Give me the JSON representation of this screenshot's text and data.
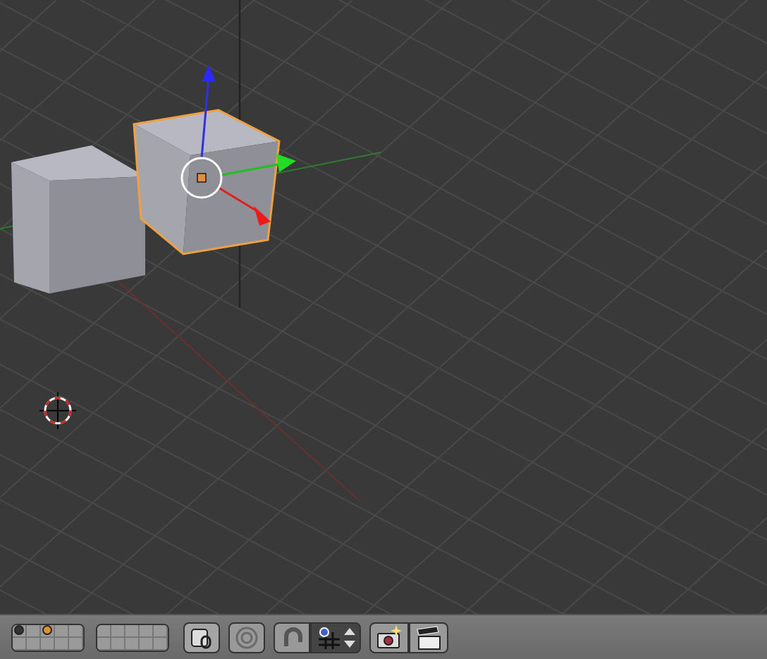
{
  "viewport": {
    "objects": [
      {
        "selected": false
      },
      {
        "selected": true
      }
    ]
  },
  "header": {
    "layer_groups": [
      [
        {
          "kind": "object"
        },
        {
          "kind": "empty"
        },
        {
          "kind": "active_object"
        },
        {
          "kind": "empty"
        },
        {
          "kind": "empty"
        },
        {
          "kind": "empty"
        },
        {
          "kind": "empty"
        },
        {
          "kind": "empty"
        },
        {
          "kind": "empty"
        },
        {
          "kind": "empty"
        }
      ],
      [
        {
          "kind": "empty"
        },
        {
          "kind": "empty"
        },
        {
          "kind": "empty"
        },
        {
          "kind": "empty"
        },
        {
          "kind": "empty"
        },
        {
          "kind": "empty"
        },
        {
          "kind": "empty"
        },
        {
          "kind": "empty"
        },
        {
          "kind": "empty"
        },
        {
          "kind": "empty"
        }
      ]
    ],
    "buttons": [
      {
        "kind": "lock",
        "on": false
      },
      {
        "kind": "proportional",
        "on": false
      },
      {
        "kind": "snap",
        "on": false
      },
      {
        "kind": "snap_element"
      },
      {
        "kind": "render"
      },
      {
        "kind": "render_anim"
      }
    ]
  }
}
